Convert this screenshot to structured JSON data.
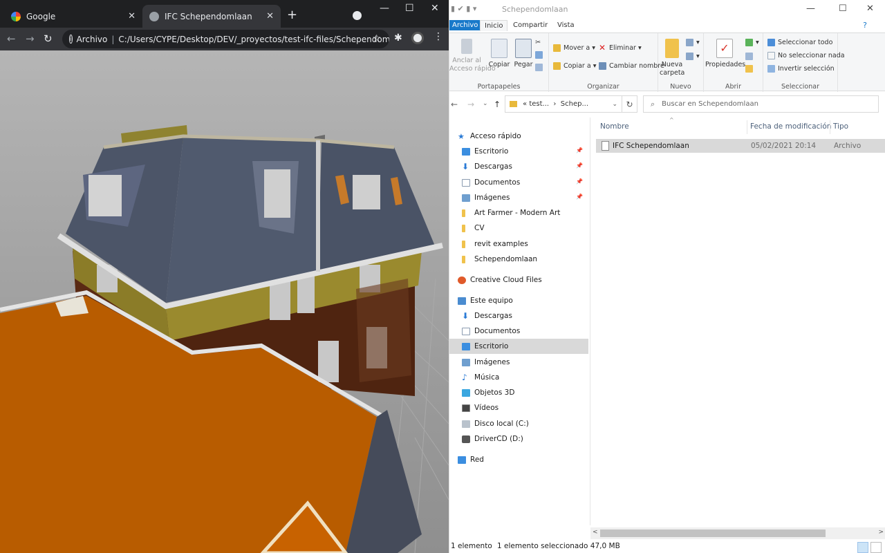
{
  "chrome": {
    "tabs": [
      {
        "title": "Google",
        "close": "✕"
      },
      {
        "title": "IFC Schependomlaan",
        "close": "✕"
      }
    ],
    "new_tab": "+",
    "window_controls": {
      "min": "—",
      "max": "☐",
      "close": "✕"
    },
    "toolbar": {
      "back": "←",
      "forward": "→",
      "reload": "↻"
    },
    "omnibox": {
      "info": "i",
      "security": "Archivo",
      "separator": "|",
      "url": "C:/Users/CYPE/Desktop/DEV/_proyectos/test-ifc-files/Schependom...",
      "star": "☆"
    },
    "extension_icon": "puzzle-icon",
    "menu": "⋮"
  },
  "viewer": {
    "description_colors": {
      "roof_slate": "#4c5568",
      "brick": "#5a2a14",
      "orange_roof": "#c55e00",
      "yellow_panel": "#8b7c28",
      "trim": "#d7d7d7"
    }
  },
  "explorer": {
    "title": "Schependomlaan",
    "window_controls": {
      "min": "—",
      "max": "☐",
      "close": "✕"
    },
    "ribbon_tabs": [
      "Archivo",
      "Inicio",
      "Compartir",
      "Vista"
    ],
    "help": "?",
    "ribbon": {
      "portapapeles": {
        "label": "Portapapeles",
        "pin": "Anclar al\nAcceso rápido",
        "copy": "Copiar",
        "paste": "Pegar"
      },
      "organizar": {
        "label": "Organizar",
        "move": "Mover a ▾",
        "copy_to": "Copiar a ▾",
        "delete": "Eliminar ▾",
        "rename": "Cambiar nombre"
      },
      "nuevo": {
        "label": "Nuevo",
        "new_folder": "Nueva\ncarpeta"
      },
      "abrir": {
        "label": "Abrir",
        "properties": "Propiedades"
      },
      "seleccionar": {
        "label": "Seleccionar",
        "all": "Seleccionar todo",
        "none": "No seleccionar nada",
        "invert": "Invertir selección"
      }
    },
    "address": {
      "back": "←",
      "forward": "→",
      "recent": "⌄",
      "up": "↑",
      "path_prefix": "«",
      "path_1": "test...",
      "path_sep": "›",
      "path_2": "Schep...",
      "dropdown": "⌄",
      "refresh": "↻"
    },
    "search": {
      "placeholder": "Buscar en Schependomlaan",
      "icon": "⌕"
    },
    "nav": {
      "quick_access": "Acceso rápido",
      "quick_items": [
        "Escritorio",
        "Descargas",
        "Documentos",
        "Imágenes",
        "Art Farmer - Modern Art",
        "CV",
        "revit examples",
        "Schependomlaan"
      ],
      "creative_cloud": "Creative Cloud Files",
      "this_pc": "Este equipo",
      "pc_items": [
        "Descargas",
        "Documentos",
        "Escritorio",
        "Imágenes",
        "Música",
        "Objetos 3D",
        "Vídeos",
        "Disco local (C:)",
        "DriverCD (D:)"
      ],
      "network": "Red"
    },
    "columns": {
      "name": "Nombre",
      "modified": "Fecha de modificación",
      "type": "Tipo"
    },
    "files": [
      {
        "name": "IFC Schependomlaan",
        "modified": "05/02/2021 20:14",
        "type": "Archivo"
      }
    ],
    "status": {
      "count": "1 elemento",
      "selected": "1 elemento seleccionado  47,0 MB"
    }
  }
}
